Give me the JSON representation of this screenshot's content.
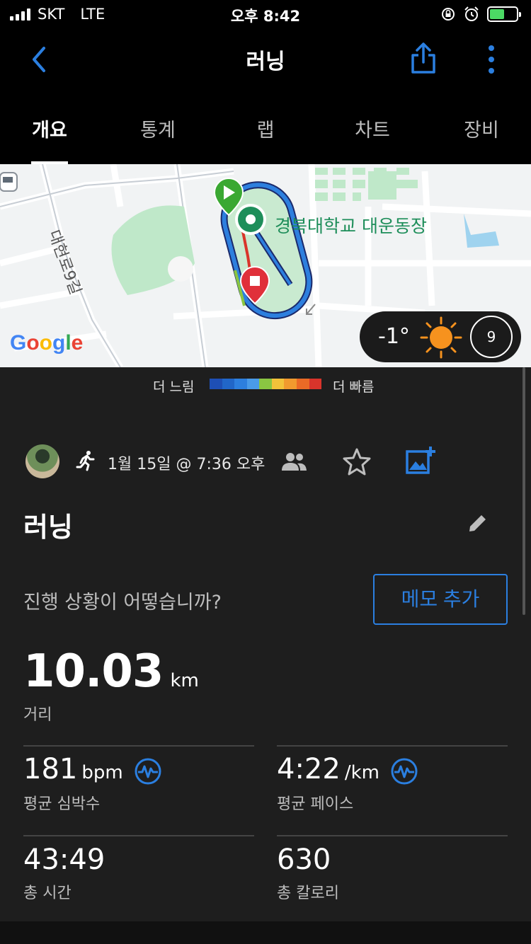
{
  "status_bar": {
    "carrier": "SKT",
    "network": "LTE",
    "time": "오후 8:42"
  },
  "header": {
    "title": "러닝"
  },
  "tabs": [
    {
      "label": "개요",
      "active": true
    },
    {
      "label": "통계"
    },
    {
      "label": "랩"
    },
    {
      "label": "차트"
    },
    {
      "label": "장비"
    }
  ],
  "map": {
    "poi_label": "경북대학교 대운동장",
    "street_label": "대현로9길",
    "attribution": "Google",
    "weather": {
      "temperature": "-1°",
      "wind": "9"
    }
  },
  "legend": {
    "slower": "더 느림",
    "faster": "더 빠름",
    "colors": [
      "#1e4fb5",
      "#2166c8",
      "#2d7fde",
      "#4a9be8",
      "#8ac542",
      "#f2c23a",
      "#f19a2e",
      "#ea6a26",
      "#d9342b"
    ]
  },
  "activity": {
    "date": "1월 15일 @ 7:36 오후",
    "name": "러닝",
    "prompt": "진행 상황이 어떻습니까?",
    "memo_button": "메모 추가"
  },
  "distance": {
    "value": "10.03",
    "unit": "km",
    "label": "거리"
  },
  "stats": {
    "avg_hr": {
      "value": "181",
      "unit": "bpm",
      "label": "평균 심박수"
    },
    "avg_pace": {
      "value": "4:22",
      "unit": "/km",
      "label": "평균 페이스"
    },
    "total_time": {
      "value": "43:49",
      "label": "총 시간"
    },
    "calories": {
      "value": "630",
      "label": "총 칼로리"
    }
  },
  "colors": {
    "accent": "#2b7fe0",
    "background": "#1e1e1e"
  }
}
